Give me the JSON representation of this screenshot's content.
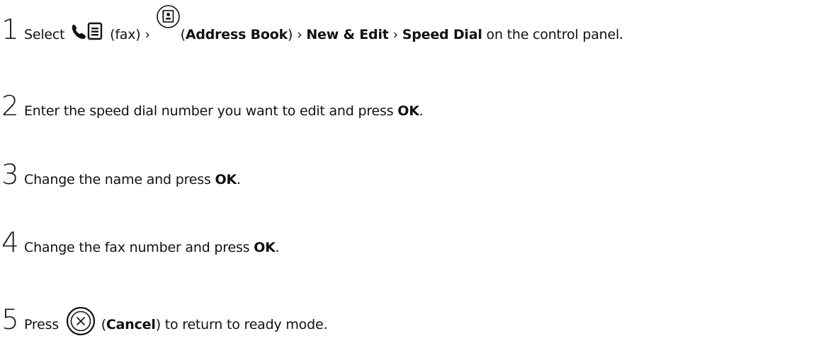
{
  "steps": [
    {
      "number": "1",
      "parts": {
        "select": "Select",
        "fax": "(fax) ›",
        "open_paren": "(",
        "address_book": "Address Book",
        "sep1": ") ›",
        "new_edit": "New & Edit",
        "sep2": "›",
        "speed_dial": "Speed Dial",
        "tail": "on the control panel."
      }
    },
    {
      "number": "2",
      "parts": {
        "text": "Enter the speed dial number you want to edit and press",
        "ok": "OK",
        "end": "."
      }
    },
    {
      "number": "3",
      "parts": {
        "text": "Change the name and press",
        "ok": "OK",
        "end": "."
      }
    },
    {
      "number": "4",
      "parts": {
        "text": "Change the fax number and press",
        "ok": "OK",
        "end": "."
      }
    },
    {
      "number": "5",
      "parts": {
        "press": "Press",
        "open_paren": "(",
        "cancel": "Cancel",
        "tail": ") to return to ready mode."
      }
    }
  ],
  "icons": {
    "fax": "fax-icon",
    "address_book": "address-book-icon",
    "cancel": "cancel-icon"
  }
}
